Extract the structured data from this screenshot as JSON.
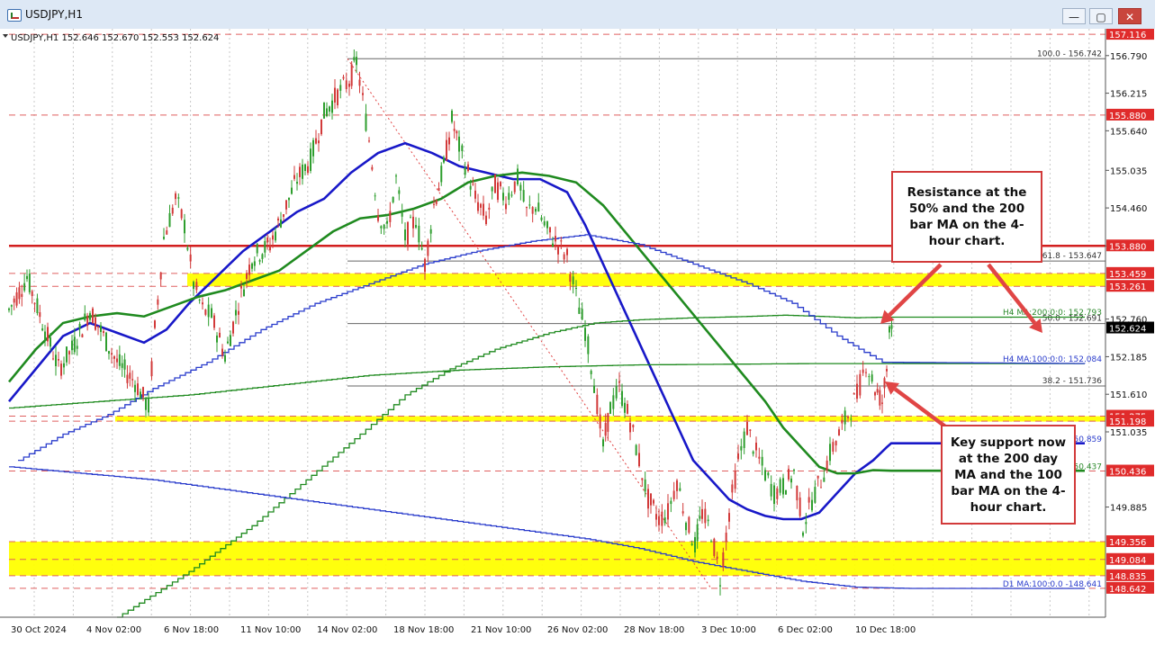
{
  "window": {
    "title": "USDJPY,H1",
    "buttons": {
      "minimize": "—",
      "restore": "▢",
      "close": "✕"
    }
  },
  "chart_data": {
    "type": "line",
    "symbol_header": "USDJPY,H1  152.646 152.670 152.553 152.624",
    "ylim": [
      148.2,
      157.2
    ],
    "y_ticks": [
      "156.790",
      "156.215",
      "155.640",
      "155.035",
      "154.460",
      "153.880",
      "152.760",
      "152.185",
      "151.610",
      "151.035",
      "149.885"
    ],
    "x_ticks": [
      "30 Oct 2024",
      "4 Nov 02:00",
      "6 Nov 18:00",
      "11 Nov 10:00",
      "14 Nov 02:00",
      "18 Nov 18:00",
      "21 Nov 10:00",
      "26 Nov 02:00",
      "28 Nov 18:00",
      "3 Dec 10:00",
      "6 Dec 02:00",
      "10 Dec 18:00"
    ],
    "current_price": "152.624",
    "price_labels": [
      {
        "value": 157.116,
        "text": "157.116",
        "style": "red"
      },
      {
        "value": 155.88,
        "text": "155.880",
        "style": "red"
      },
      {
        "value": 153.88,
        "text": "153.880",
        "style": "red"
      },
      {
        "value": 153.459,
        "text": "153.459",
        "style": "red"
      },
      {
        "value": 153.261,
        "text": "153.261",
        "style": "red"
      },
      {
        "value": 151.275,
        "text": "151.275",
        "style": "red"
      },
      {
        "value": 151.198,
        "text": "151.198",
        "style": "red"
      },
      {
        "value": 150.436,
        "text": "150.436",
        "style": "red"
      },
      {
        "value": 149.356,
        "text": "149.356",
        "style": "red"
      },
      {
        "value": 149.084,
        "text": "149.084",
        "style": "red"
      },
      {
        "value": 148.835,
        "text": "148.835",
        "style": "red"
      },
      {
        "value": 148.642,
        "text": "148.642",
        "style": "red"
      }
    ],
    "fib_levels": [
      {
        "label": "100.0 - 156.742",
        "value": 156.742
      },
      {
        "label": "61.8 - 153.647",
        "value": 153.647
      },
      {
        "label": "50.0 - 152.691",
        "value": 152.691
      },
      {
        "label": "38.2 - 151.736",
        "value": 151.736
      }
    ],
    "zones": [
      {
        "low": 153.261,
        "high": 153.459
      },
      {
        "low": 151.198,
        "high": 151.275
      },
      {
        "low": 148.835,
        "high": 149.356
      }
    ],
    "ma_labels": [
      {
        "text": "H4 MA:200:0:0: 152.793",
        "value": 152.793,
        "color": "#2c8a2c"
      },
      {
        "text": "H4 MA:100:0:0: 152.084",
        "value": 152.084,
        "color": "#2a3ccc"
      },
      {
        "text": "50.859",
        "value": 150.859,
        "color": "#2a3ccc"
      },
      {
        "text": "50.437",
        "value": 150.437,
        "color": "#2c8a2c"
      },
      {
        "text": "D1 MA:100:0.0 -148.641",
        "value": 148.641,
        "color": "#2a3ccc"
      }
    ],
    "price_path": [
      [
        0,
        152.9
      ],
      [
        20,
        153.4
      ],
      [
        40,
        152.6
      ],
      [
        55,
        152.0
      ],
      [
        70,
        152.3
      ],
      [
        90,
        152.9
      ],
      [
        105,
        152.5
      ],
      [
        120,
        152.1
      ],
      [
        140,
        151.8
      ],
      [
        155,
        151.4
      ],
      [
        162,
        152.6
      ],
      [
        172,
        154.0
      ],
      [
        185,
        154.6
      ],
      [
        195,
        154.2
      ],
      [
        205,
        153.3
      ],
      [
        215,
        152.9
      ],
      [
        225,
        152.8
      ],
      [
        240,
        152.2
      ],
      [
        255,
        153.0
      ],
      [
        270,
        153.7
      ],
      [
        290,
        153.9
      ],
      [
        305,
        154.4
      ],
      [
        320,
        154.9
      ],
      [
        335,
        155.2
      ],
      [
        350,
        155.9
      ],
      [
        365,
        156.2
      ],
      [
        378,
        156.4
      ],
      [
        386,
        156.7
      ],
      [
        393,
        156.1
      ],
      [
        400,
        155.5
      ],
      [
        410,
        154.4
      ],
      [
        420,
        154.1
      ],
      [
        430,
        154.9
      ],
      [
        440,
        154.0
      ],
      [
        452,
        154.3
      ],
      [
        462,
        153.6
      ],
      [
        472,
        154.5
      ],
      [
        483,
        155.1
      ],
      [
        492,
        155.8
      ],
      [
        500,
        155.4
      ],
      [
        510,
        155.0
      ],
      [
        518,
        154.6
      ],
      [
        530,
        154.3
      ],
      [
        540,
        154.8
      ],
      [
        552,
        154.6
      ],
      [
        565,
        154.9
      ],
      [
        575,
        154.4
      ],
      [
        585,
        154.5
      ],
      [
        598,
        154.1
      ],
      [
        610,
        153.9
      ],
      [
        620,
        153.7
      ],
      [
        630,
        153.1
      ],
      [
        640,
        152.6
      ],
      [
        650,
        151.8
      ],
      [
        660,
        150.8
      ],
      [
        668,
        151.4
      ],
      [
        678,
        151.7
      ],
      [
        690,
        151.2
      ],
      [
        700,
        150.6
      ],
      [
        710,
        150.0
      ],
      [
        722,
        149.7
      ],
      [
        732,
        149.8
      ],
      [
        742,
        150.3
      ],
      [
        752,
        149.7
      ],
      [
        762,
        149.3
      ],
      [
        770,
        149.8
      ],
      [
        780,
        149.5
      ],
      [
        790,
        148.8
      ],
      [
        800,
        149.8
      ],
      [
        810,
        150.6
      ],
      [
        820,
        151.1
      ],
      [
        830,
        150.7
      ],
      [
        840,
        150.4
      ],
      [
        850,
        150.1
      ],
      [
        860,
        150.2
      ],
      [
        872,
        150.4
      ],
      [
        882,
        149.6
      ],
      [
        892,
        150.0
      ],
      [
        902,
        150.3
      ],
      [
        912,
        150.7
      ],
      [
        922,
        151.0
      ],
      [
        932,
        151.3
      ],
      [
        942,
        151.6
      ],
      [
        952,
        152.1
      ],
      [
        962,
        151.7
      ],
      [
        970,
        151.5
      ],
      [
        975,
        152.0
      ],
      [
        978,
        152.7
      ],
      [
        983,
        152.62
      ]
    ],
    "series": [
      {
        "name": "",
        "color": "#1818c8",
        "width": 2.6,
        "points": [
          [
            0,
            151.5
          ],
          [
            30,
            152.0
          ],
          [
            60,
            152.5
          ],
          [
            90,
            152.7
          ],
          [
            120,
            152.55
          ],
          [
            150,
            152.4
          ],
          [
            175,
            152.6
          ],
          [
            200,
            153.0
          ],
          [
            230,
            153.4
          ],
          [
            260,
            153.8
          ],
          [
            290,
            154.1
          ],
          [
            320,
            154.4
          ],
          [
            350,
            154.6
          ],
          [
            380,
            155.0
          ],
          [
            410,
            155.3
          ],
          [
            440,
            155.45
          ],
          [
            470,
            155.3
          ],
          [
            500,
            155.1
          ],
          [
            530,
            155.0
          ],
          [
            560,
            154.9
          ],
          [
            590,
            154.9
          ],
          [
            620,
            154.7
          ],
          [
            640,
            154.2
          ],
          [
            660,
            153.6
          ],
          [
            680,
            153.0
          ],
          [
            700,
            152.4
          ],
          [
            720,
            151.8
          ],
          [
            740,
            151.2
          ],
          [
            760,
            150.6
          ],
          [
            780,
            150.3
          ],
          [
            800,
            150.0
          ],
          [
            820,
            149.85
          ],
          [
            840,
            149.75
          ],
          [
            860,
            149.7
          ],
          [
            880,
            149.7
          ],
          [
            900,
            149.8
          ],
          [
            920,
            150.1
          ],
          [
            940,
            150.4
          ],
          [
            960,
            150.6
          ],
          [
            975,
            150.8
          ],
          [
            980,
            150.86
          ],
          [
            1195,
            150.86
          ]
        ]
      },
      {
        "name": "",
        "color": "#1f8a1f",
        "width": 2.6,
        "points": [
          [
            0,
            151.8
          ],
          [
            30,
            152.3
          ],
          [
            60,
            152.7
          ],
          [
            90,
            152.8
          ],
          [
            120,
            152.85
          ],
          [
            150,
            152.8
          ],
          [
            180,
            152.95
          ],
          [
            210,
            153.1
          ],
          [
            240,
            153.2
          ],
          [
            270,
            153.35
          ],
          [
            300,
            153.5
          ],
          [
            330,
            153.8
          ],
          [
            360,
            154.1
          ],
          [
            390,
            154.3
          ],
          [
            420,
            154.35
          ],
          [
            450,
            154.45
          ],
          [
            480,
            154.6
          ],
          [
            510,
            154.85
          ],
          [
            540,
            154.95
          ],
          [
            570,
            155.0
          ],
          [
            600,
            154.95
          ],
          [
            630,
            154.85
          ],
          [
            660,
            154.5
          ],
          [
            690,
            154.0
          ],
          [
            720,
            153.5
          ],
          [
            750,
            153.0
          ],
          [
            780,
            152.5
          ],
          [
            810,
            152.0
          ],
          [
            840,
            151.5
          ],
          [
            860,
            151.1
          ],
          [
            880,
            150.8
          ],
          [
            900,
            150.5
          ],
          [
            920,
            150.4
          ],
          [
            940,
            150.4
          ],
          [
            960,
            150.45
          ],
          [
            980,
            150.44
          ],
          [
            1195,
            150.44
          ]
        ]
      },
      {
        "name": "",
        "color": "#1f8a1f",
        "width": 1.3,
        "stepped": true,
        "points": [
          [
            0,
            151.4
          ],
          [
            100,
            151.5
          ],
          [
            200,
            151.6
          ],
          [
            300,
            151.75
          ],
          [
            400,
            151.9
          ],
          [
            500,
            151.98
          ],
          [
            600,
            152.03
          ],
          [
            700,
            152.06
          ],
          [
            800,
            152.07
          ],
          [
            900,
            152.08
          ],
          [
            970,
            152.08
          ],
          [
            1195,
            152.08
          ]
        ]
      },
      {
        "name": "",
        "color": "#1f8a1f",
        "width": 1.3,
        "stepped": true,
        "points": [
          [
            120,
            148.2
          ],
          [
            200,
            148.9
          ],
          [
            270,
            149.6
          ],
          [
            330,
            150.3
          ],
          [
            390,
            151.0
          ],
          [
            440,
            151.6
          ],
          [
            490,
            152.0
          ],
          [
            540,
            152.3
          ],
          [
            600,
            152.55
          ],
          [
            650,
            152.7
          ],
          [
            700,
            152.75
          ],
          [
            760,
            152.78
          ],
          [
            820,
            152.8
          ],
          [
            860,
            152.82
          ],
          [
            900,
            152.8
          ],
          [
            940,
            152.78
          ],
          [
            970,
            152.79
          ],
          [
            1195,
            152.79
          ]
        ]
      },
      {
        "name": "",
        "color": "#2a3ccc",
        "width": 1.3,
        "stepped": true,
        "points": [
          [
            10,
            150.6
          ],
          [
            60,
            151.0
          ],
          [
            110,
            151.3
          ],
          [
            160,
            151.7
          ],
          [
            220,
            152.1
          ],
          [
            280,
            152.6
          ],
          [
            340,
            153.0
          ],
          [
            400,
            153.3
          ],
          [
            460,
            153.6
          ],
          [
            520,
            153.8
          ],
          [
            580,
            153.95
          ],
          [
            640,
            154.05
          ],
          [
            700,
            153.9
          ],
          [
            760,
            153.6
          ],
          [
            820,
            153.3
          ],
          [
            870,
            153.0
          ],
          [
            920,
            152.5
          ],
          [
            950,
            152.25
          ],
          [
            970,
            152.1
          ],
          [
            1195,
            152.08
          ]
        ]
      },
      {
        "name": "",
        "color": "#2a3ccc",
        "width": 1.3,
        "stepped": true,
        "points": [
          [
            0,
            150.5
          ],
          [
            80,
            150.4
          ],
          [
            160,
            150.3
          ],
          [
            240,
            150.15
          ],
          [
            320,
            150.0
          ],
          [
            400,
            149.85
          ],
          [
            480,
            149.7
          ],
          [
            560,
            149.55
          ],
          [
            640,
            149.4
          ],
          [
            700,
            149.25
          ],
          [
            760,
            149.05
          ],
          [
            820,
            148.9
          ],
          [
            880,
            148.75
          ],
          [
            940,
            148.66
          ],
          [
            1000,
            148.64
          ],
          [
            1195,
            148.64
          ]
        ]
      }
    ]
  },
  "annotations": [
    {
      "text": "Resistance at the 50% and the 200 bar MA on the 4-hour chart."
    },
    {
      "text": "Key support now at the 200 day MA and the 100 bar MA on the 4-hour chart."
    }
  ]
}
